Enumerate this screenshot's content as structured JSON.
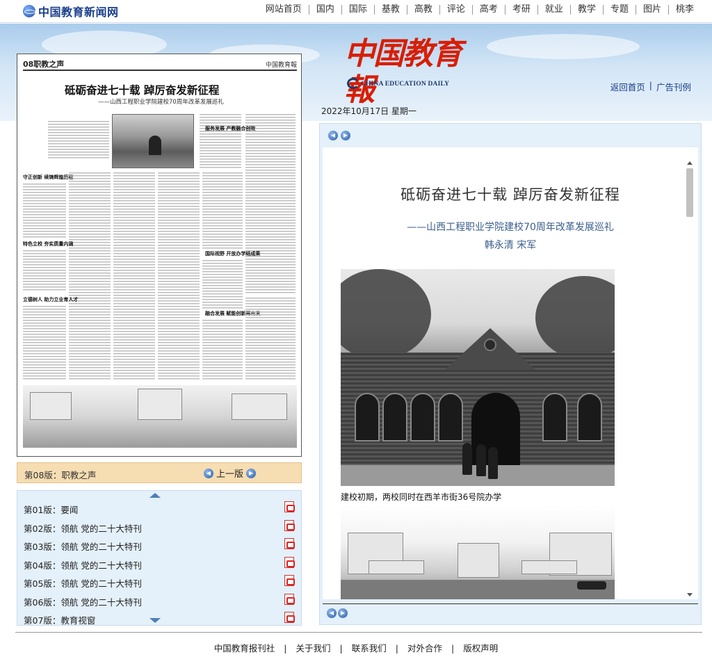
{
  "site": {
    "name": "中国教育新闻网"
  },
  "topnav": [
    "网站首页",
    "国内",
    "国际",
    "基教",
    "高教",
    "评论",
    "高考",
    "考研",
    "就业",
    "教学",
    "专题",
    "图片",
    "桃李"
  ],
  "paper": {
    "name_cn": "中国教育報",
    "name_en": "CHINA EDUCATION DAILY"
  },
  "head_links": {
    "home": "返回首页",
    "ads": "广告刊例"
  },
  "date": "2022年10月17日  星期一",
  "preview": {
    "section": "08职教之声",
    "masthead": "中国教育報",
    "title": "砥砺奋进七十载  踔厉奋发新征程",
    "subtitle": "——山西工程职业学院建校70周年改革发展巡礼",
    "sections": [
      "守正创新 续铸辉煌历程",
      "特色立校 夯实质量内涵",
      "立德树人 助力立业育人才",
      "服务发展 产教融合创效",
      "国际视野 开放办学结成果",
      "融合发展 赋能创新再出发"
    ]
  },
  "edition_bar": {
    "label": "第08版：职教之声",
    "prev": "上一版"
  },
  "editions": [
    "第01版：要闻",
    "第02版：领航 党的二十大特刊",
    "第03版：领航 党的二十大特刊",
    "第04版：领航 党的二十大特刊",
    "第05版：领航 党的二十大特刊",
    "第06版：领航 党的二十大特刊",
    "第07版：教育视窗"
  ],
  "article": {
    "title": "砥砺奋进七十载  踔厉奋发新征程",
    "subtitle": "——山西工程职业学院建校70周年改革发展巡礼",
    "authors": "韩永清  宋军",
    "photo1_caption": "建校初期，两校同时在西羊市街36号院办学"
  },
  "footer": [
    "中国教育报刊社",
    "关于我们",
    "联系我们",
    "对外合作",
    "版权声明"
  ]
}
